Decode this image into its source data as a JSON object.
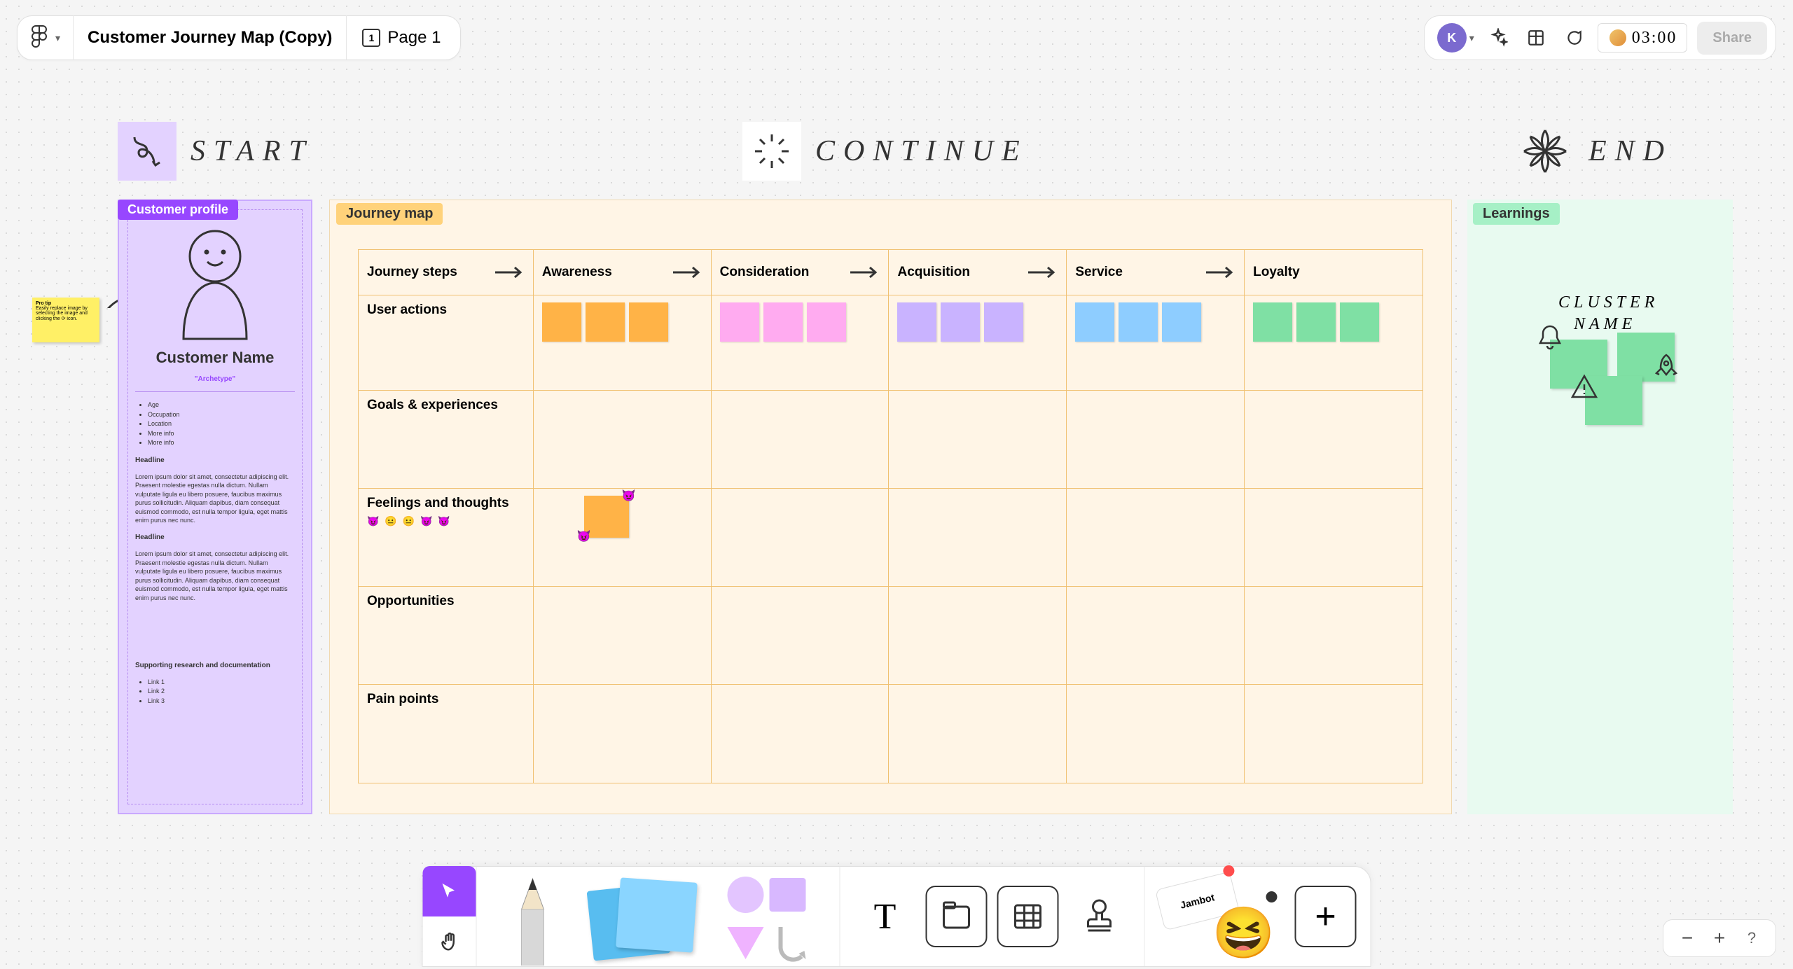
{
  "header": {
    "file_title": "Customer Journey Map (Copy)",
    "page_label": "Page 1",
    "page_number": "1",
    "avatar_initial": "K",
    "timer": "03:00",
    "share_label": "Share"
  },
  "sections": {
    "start": "START",
    "continue": "CONTINUE",
    "end": "END"
  },
  "protip": {
    "title": "Pro tip",
    "body": "Easily replace image by selecting the image and clicking the ⟳ icon."
  },
  "profile": {
    "tag": "Customer profile",
    "customer_name": "Customer Name",
    "archetype": "\"Archetype\"",
    "bullets": [
      "Age",
      "Occupation",
      "Location",
      "More info",
      "More info"
    ],
    "headline1": "Headline",
    "para1": "Lorem ipsum dolor sit amet, consectetur adipiscing elit. Praesent molestie egestas nulla dictum. Nullam vulputate ligula eu libero posuere, faucibus maximus purus sollicitudin. Aliquam dapibus, diam consequat euismod commodo, est nulla tempor ligula, eget mattis enim purus nec nunc.",
    "headline2": "Headline",
    "para2": "Lorem ipsum dolor sit amet, consectetur adipiscing elit. Praesent molestie egestas nulla dictum. Nullam vulputate ligula eu libero posuere, faucibus maximus purus sollicitudin. Aliquam dapibus, diam consequat euismod commodo, est nulla tempor ligula, eget mattis enim purus nec nunc.",
    "support_head": "Supporting research and documentation",
    "links": [
      "Link 1",
      "Link 2",
      "Link 3"
    ]
  },
  "journey": {
    "tag": "Journey map",
    "col_steps": "Journey steps",
    "cols": [
      "Awareness",
      "Consideration",
      "Acquisition",
      "Service",
      "Loyalty"
    ],
    "rows": [
      "User actions",
      "Goals & experiences",
      "Feelings and thoughts",
      "Opportunities",
      "Pain points"
    ],
    "emojis": "😈 😐 😐 😈 😈"
  },
  "learnings": {
    "tag": "Learnings",
    "cluster_label_1": "CLUSTER",
    "cluster_label_2": "NAME"
  },
  "toolbar": {
    "jambot": "Jambot"
  },
  "zoom": {
    "minus": "−",
    "plus": "+",
    "help": "?"
  }
}
